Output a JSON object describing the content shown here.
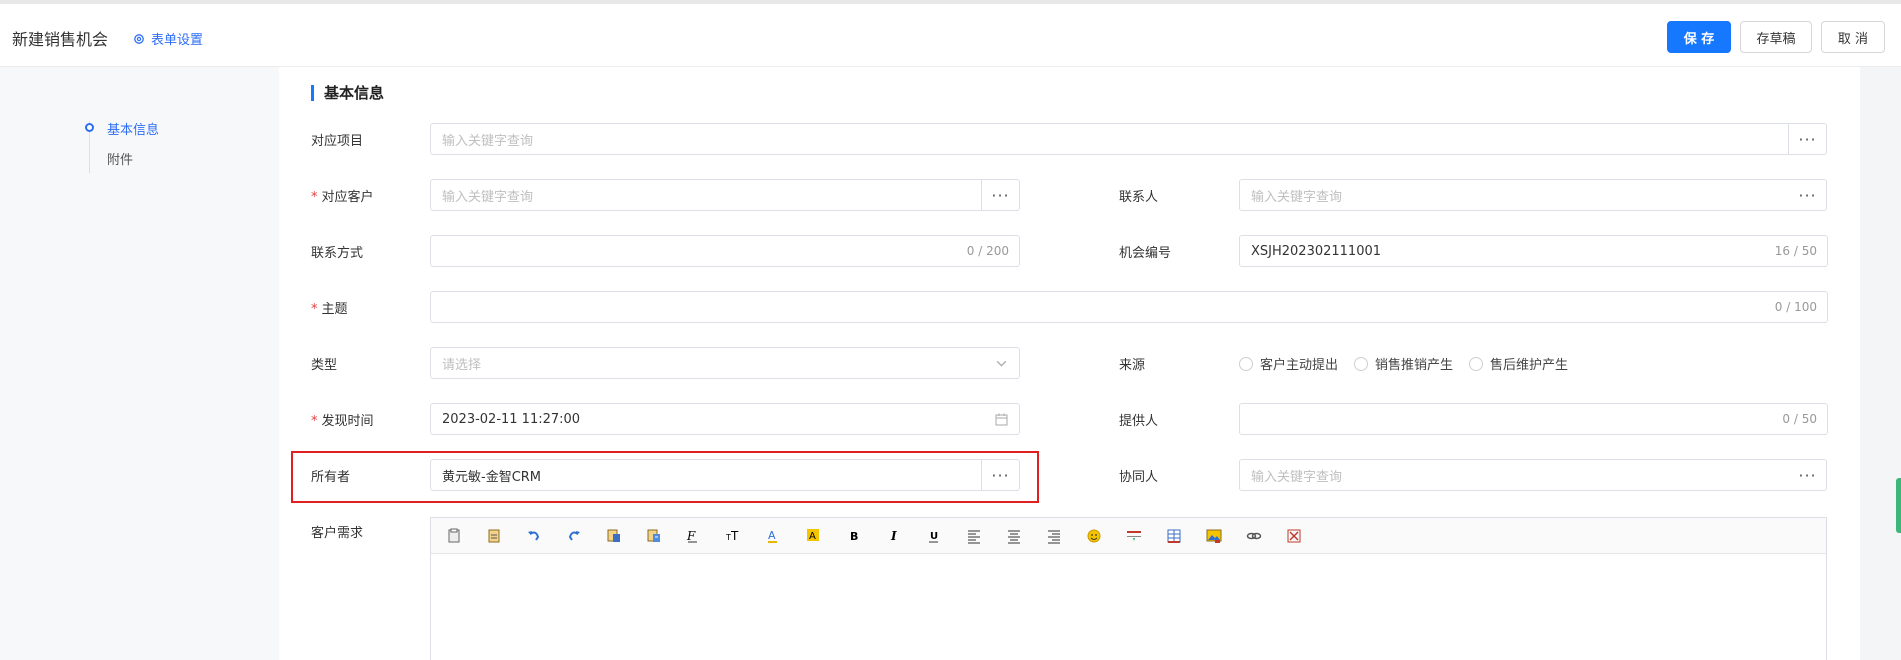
{
  "header": {
    "title": "新建销售机会",
    "form_settings": "表单设置",
    "save": "保 存",
    "draft": "存草稿",
    "cancel": "取 消"
  },
  "nav": {
    "items": [
      {
        "label": "基本信息",
        "active": true
      },
      {
        "label": "附件",
        "active": false
      }
    ]
  },
  "section": {
    "title": "基本信息"
  },
  "fields": {
    "project": {
      "label": "对应项目",
      "placeholder": "输入关键字查询"
    },
    "customer": {
      "label": "对应客户",
      "placeholder": "输入关键字查询",
      "required": "*"
    },
    "contact": {
      "label": "联系人",
      "placeholder": "输入关键字查询"
    },
    "contact_method": {
      "label": "联系方式",
      "value": "",
      "counter": "0 / 200"
    },
    "opportunity_no": {
      "label": "机会编号",
      "value": "XSJH202302111001",
      "counter": "16 / 50"
    },
    "subject": {
      "label": "主题",
      "required": "*",
      "counter": "0 / 100"
    },
    "type": {
      "label": "类型",
      "placeholder": "请选择"
    },
    "source": {
      "label": "来源",
      "options": [
        "客户主动提出",
        "销售推销产生",
        "售后维护产生"
      ]
    },
    "found_time": {
      "label": "发现时间",
      "required": "*",
      "value": "2023-02-11 11:27:00"
    },
    "provider": {
      "label": "提供人",
      "counter": "0 / 50"
    },
    "owner": {
      "label": "所有者",
      "value": "黄元敏-金智CRM"
    },
    "collaborator": {
      "label": "协同人",
      "placeholder": "输入关键字查询"
    },
    "requirement": {
      "label": "客户需求"
    }
  },
  "dots": "···",
  "toolbar_icons": [
    "paste-icon",
    "paste-text-icon",
    "undo-icon",
    "redo-icon",
    "paste-word-icon",
    "format-painter-icon",
    "font-family-icon",
    "font-size-icon",
    "font-color-icon",
    "background-color-icon",
    "bold-icon",
    "italic-icon",
    "underline-icon",
    "align-left-icon",
    "align-center-icon",
    "align-right-icon",
    "emoji-icon",
    "horizontal-rule-icon",
    "table-icon",
    "image-icon",
    "link-icon",
    "unlink-icon"
  ]
}
